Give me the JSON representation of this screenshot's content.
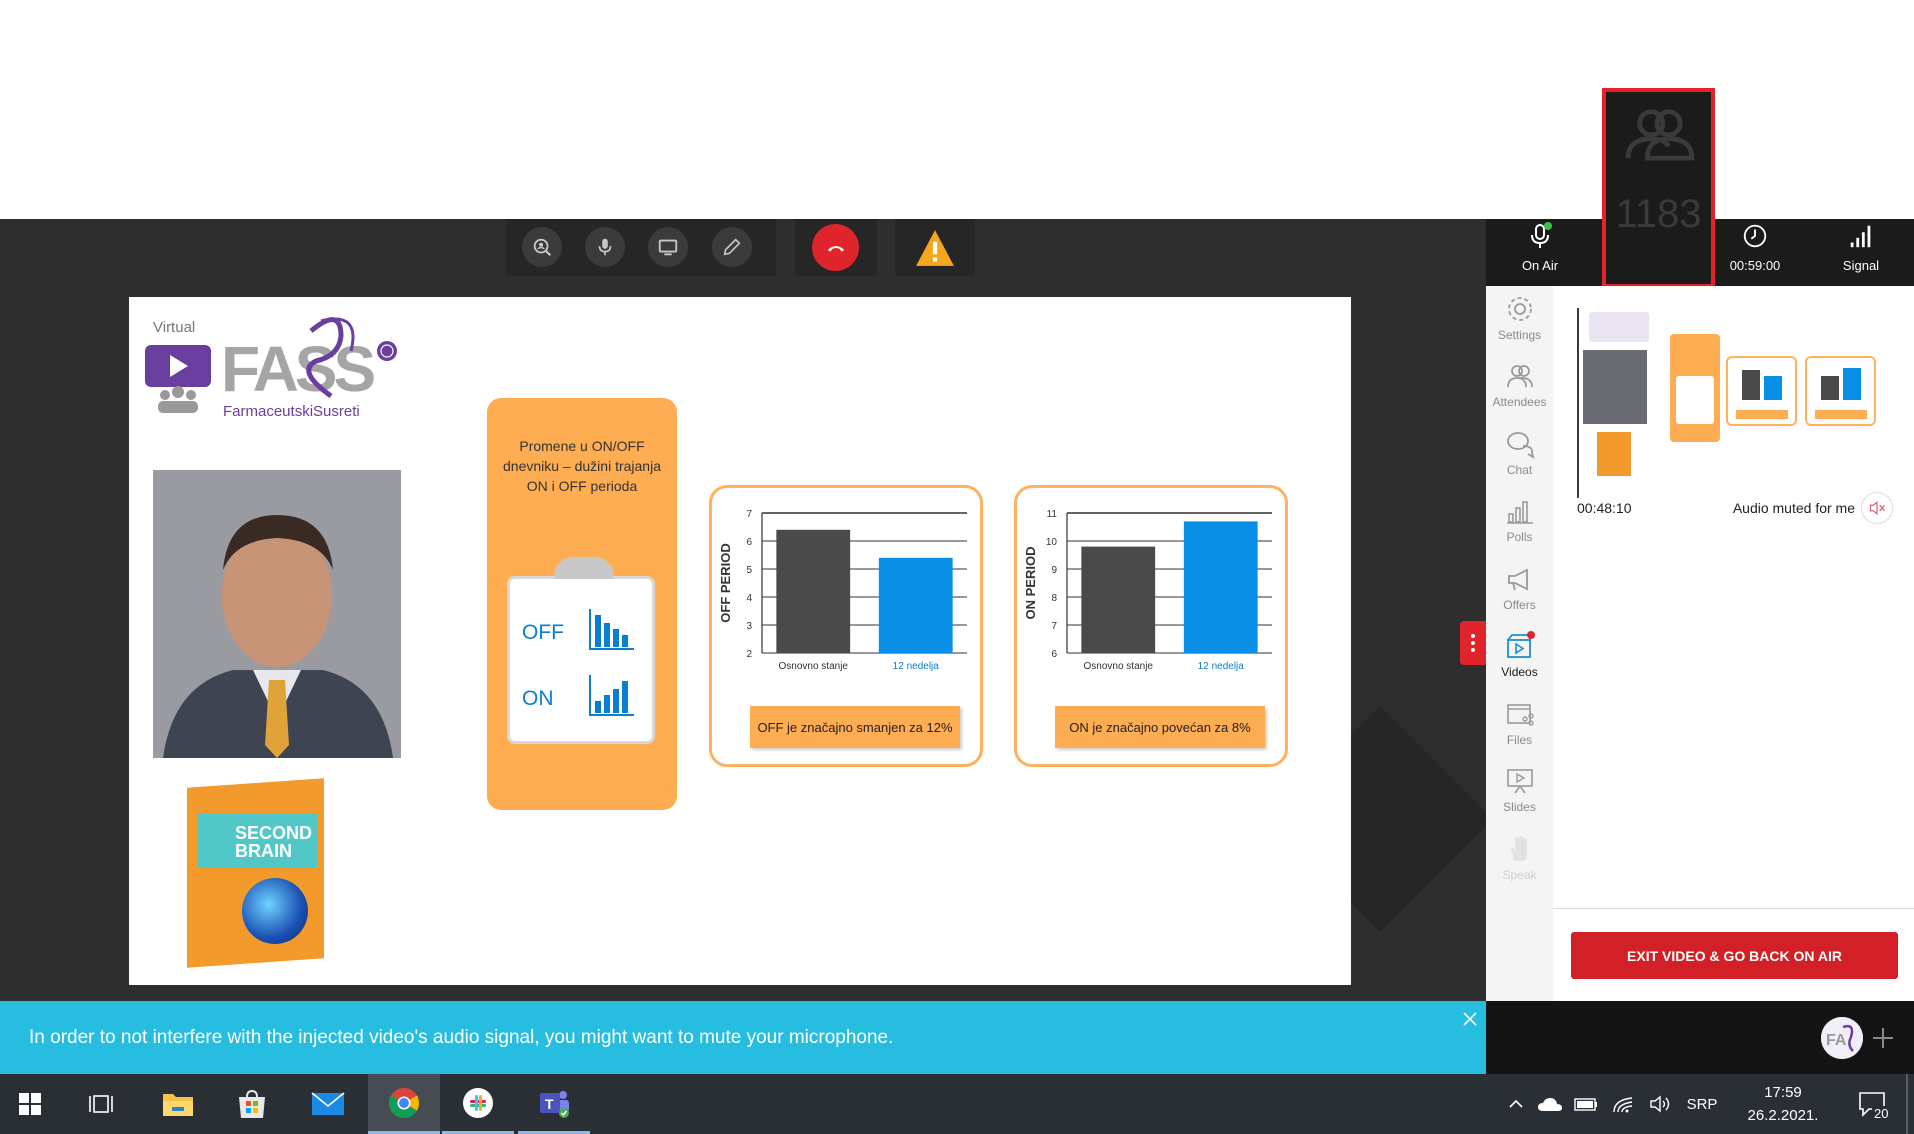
{
  "toolbar": {
    "buttons": [
      "search-user-icon",
      "microphone-icon",
      "screen-share-icon",
      "pen-icon",
      "hang-up-icon",
      "warning-icon"
    ]
  },
  "status_bar": {
    "on_air_label": "On Air",
    "attendee_count": "1183",
    "timer": "00:59:00",
    "signal_label": "Signal"
  },
  "sidebar": {
    "items": [
      {
        "label": "Settings",
        "icon": "gear-icon"
      },
      {
        "label": "Attendees",
        "icon": "attendees-icon"
      },
      {
        "label": "Chat",
        "icon": "chat-icon"
      },
      {
        "label": "Polls",
        "icon": "polls-icon"
      },
      {
        "label": "Offers",
        "icon": "megaphone-icon"
      },
      {
        "label": "Videos",
        "icon": "video-icon"
      },
      {
        "label": "Files",
        "icon": "files-icon"
      },
      {
        "label": "Slides",
        "icon": "slides-icon"
      },
      {
        "label": "Speak",
        "icon": "hand-icon"
      }
    ]
  },
  "video_panel": {
    "elapsed": "00:48:10",
    "audio_status": "Audio muted for me",
    "exit_button": "EXIT VIDEO & GO BACK ON AIR"
  },
  "banner": {
    "message": "In order to not interfere with the injected video's audio signal, you might want to mute your microphone."
  },
  "slide": {
    "logo_virtual": "Virtual",
    "logo_brand": "FarmaceutskiSusreti",
    "product_line1": "SECOND",
    "product_line2": "BRAIN",
    "card_title": "Promene u ON/OFF dnevniku – dužini trajanja ON i OFF perioda",
    "off_label": "OFF",
    "on_label": "ON"
  },
  "chart_data": [
    {
      "type": "bar",
      "categories": [
        "Osnovno stanje",
        "12 nedelja"
      ],
      "values": [
        6.4,
        5.4
      ],
      "colors": [
        "#4a4a4a",
        "#0a8fe6"
      ],
      "ylabel": "OFF PERIOD",
      "ylim": [
        2,
        7
      ],
      "yticks": [
        "2",
        "3",
        "4",
        "5",
        "6",
        "7"
      ],
      "grid": true,
      "caption": "OFF je značajno smanjen za 12%"
    },
    {
      "type": "bar",
      "categories": [
        "Osnovno stanje",
        "12 nedelja"
      ],
      "values": [
        9.8,
        10.7
      ],
      "colors": [
        "#4a4a4a",
        "#0a8fe6"
      ],
      "ylabel": "ON PERIOD",
      "ylim": [
        6,
        11
      ],
      "yticks": [
        "6",
        "7",
        "8",
        "9",
        "10",
        "11"
      ],
      "grid": true,
      "caption": "ON je značajno povećan za 8%"
    }
  ],
  "taskbar": {
    "language": "SRP",
    "time": "17:59",
    "date": "26.2.2021.",
    "notifications": "20"
  }
}
